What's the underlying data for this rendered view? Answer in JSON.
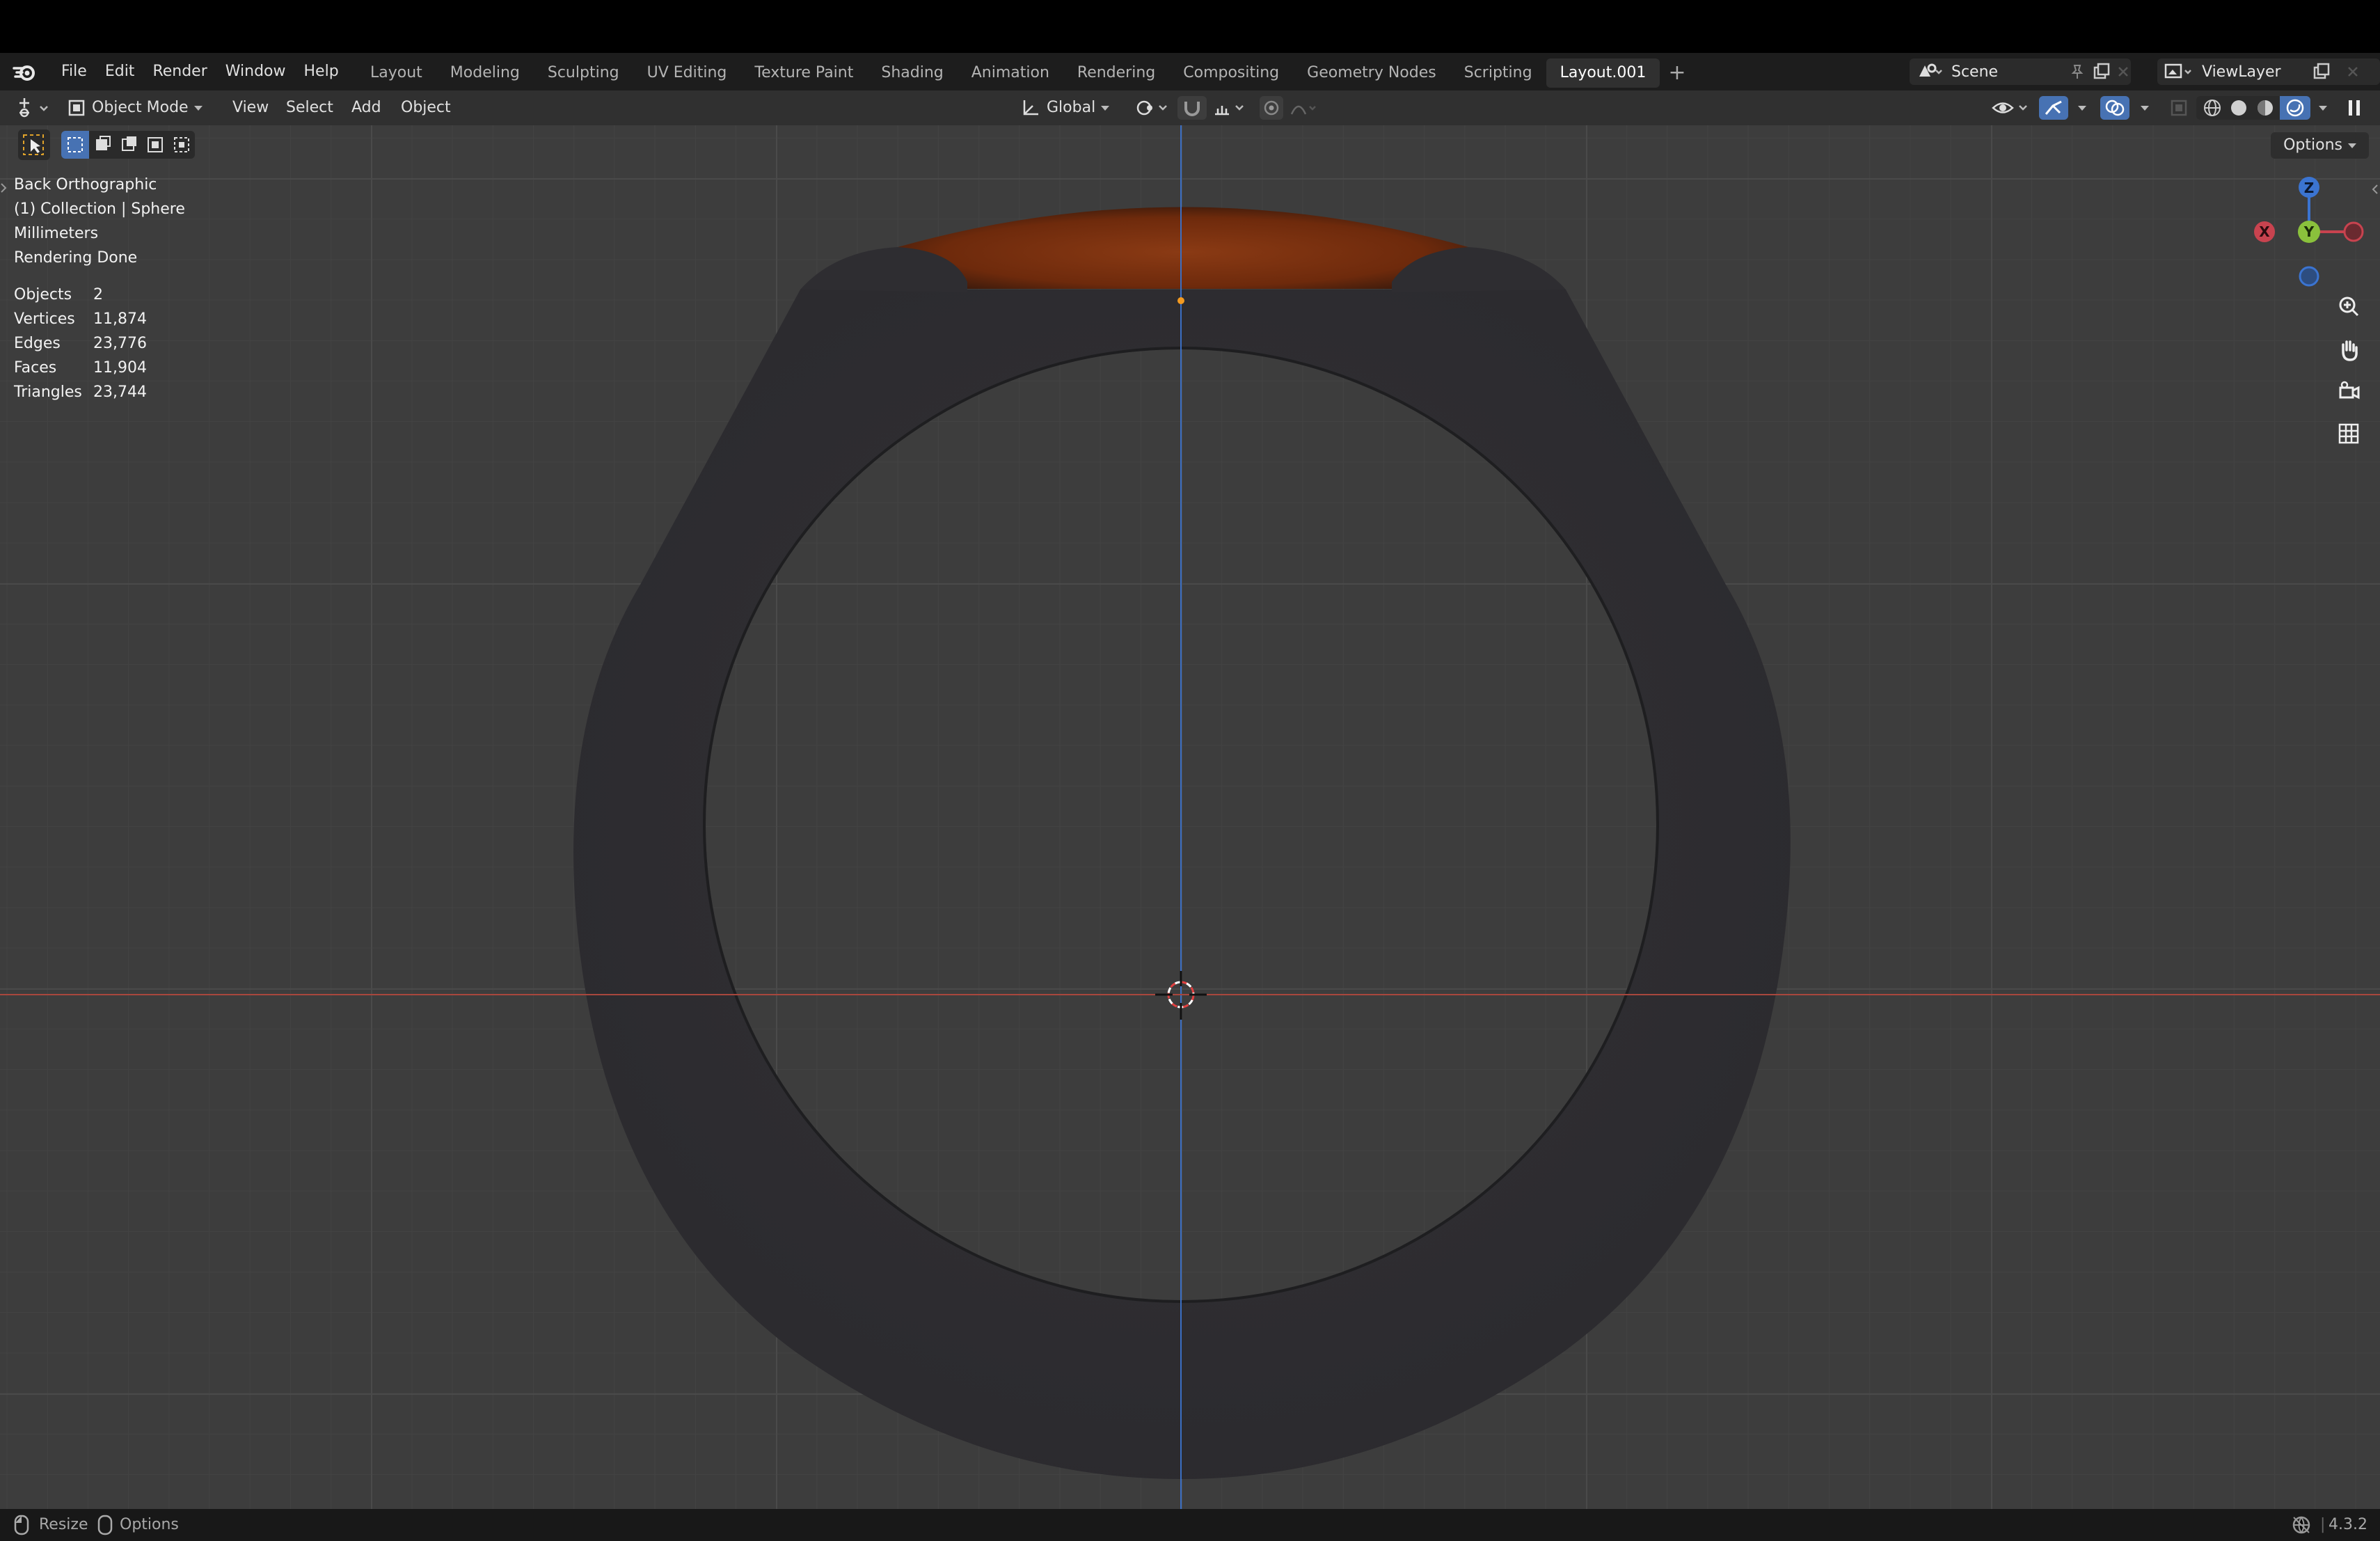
{
  "menu": {
    "items": [
      "File",
      "Edit",
      "Render",
      "Window",
      "Help"
    ]
  },
  "workspaces": {
    "tabs": [
      "Layout",
      "Modeling",
      "Sculpting",
      "UV Editing",
      "Texture Paint",
      "Shading",
      "Animation",
      "Rendering",
      "Compositing",
      "Geometry Nodes",
      "Scripting",
      "Layout.001"
    ],
    "active": "Layout.001"
  },
  "scene": {
    "label": "Scene"
  },
  "view_layer": {
    "label": "ViewLayer"
  },
  "viewport_header": {
    "mode": "Object Mode",
    "menus": [
      "View",
      "Select",
      "Add",
      "Object"
    ],
    "transform_orientation": "Global",
    "options": "Options"
  },
  "overlay": {
    "view_name": "Back Orthographic",
    "collection": "(1) Collection | Sphere",
    "units": "Millimeters",
    "render_status": "Rendering Done",
    "stats": [
      {
        "label": "Objects",
        "value": "2"
      },
      {
        "label": "Vertices",
        "value": "11,874"
      },
      {
        "label": "Edges",
        "value": "23,776"
      },
      {
        "label": "Faces",
        "value": "11,904"
      },
      {
        "label": "Triangles",
        "value": "23,744"
      }
    ]
  },
  "gizmo": {
    "z": "Z",
    "y": "Y",
    "x": "X"
  },
  "statusbar": {
    "resize": "Resize",
    "options": "Options",
    "version": "4.3.2"
  },
  "colors": {
    "accent_blue": "#4772b3",
    "axis_red": "#c8434f",
    "axis_green": "#8ac13c",
    "axis_blue": "#3b74d1",
    "gem": "#7a2f10"
  }
}
